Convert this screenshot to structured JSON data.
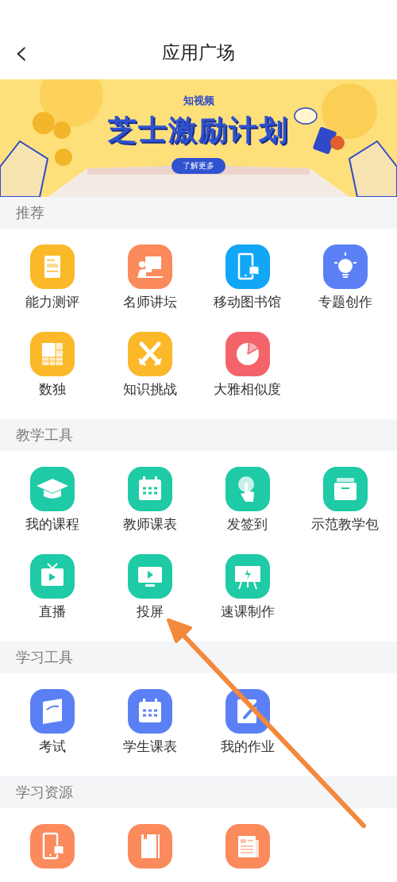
{
  "header": {
    "back": "‹",
    "title": "应用广场"
  },
  "banner": {
    "kind": "picture",
    "brand": "知视频",
    "headline": "芝士激励计划",
    "button": "了解更多"
  },
  "sections": [
    {
      "title": "推荐",
      "items": [
        {
          "label": "能力测评",
          "color": "#fbb829"
        },
        {
          "label": "名师讲坛",
          "color": "#fb8a5c"
        },
        {
          "label": "移动图书馆",
          "color": "#12a6f6"
        },
        {
          "label": "专题创作",
          "color": "#5b80f6"
        },
        {
          "label": "数独",
          "color": "#fbb829"
        },
        {
          "label": "知识挑战",
          "color": "#fbb829"
        },
        {
          "label": "大雅相似度",
          "color": "#f5636a"
        }
      ]
    },
    {
      "title": "教学工具",
      "items": [
        {
          "label": "我的课程",
          "color": "#1fcaa6"
        },
        {
          "label": "教师课表",
          "color": "#1fcaa6"
        },
        {
          "label": "发签到",
          "color": "#1fcaa6"
        },
        {
          "label": "示范教学包",
          "color": "#1fcaa6"
        },
        {
          "label": "直播",
          "color": "#1fcaa6"
        },
        {
          "label": "投屏",
          "color": "#1fcaa6"
        },
        {
          "label": "速课制作",
          "color": "#1fcaa6"
        }
      ]
    },
    {
      "title": "学习工具",
      "items": [
        {
          "label": "考试",
          "color": "#5b80f6"
        },
        {
          "label": "学生课表",
          "color": "#5b80f6"
        },
        {
          "label": "我的作业",
          "color": "#5b80f6"
        }
      ]
    },
    {
      "title": "学习资源",
      "items": [
        {
          "color": "#fb8a5c"
        },
        {
          "color": "#fb8a5c"
        },
        {
          "color": "#fb8a5c"
        }
      ]
    }
  ]
}
